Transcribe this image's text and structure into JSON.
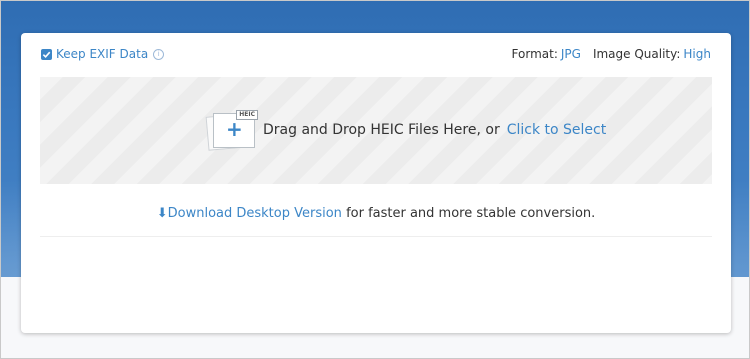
{
  "options": {
    "keep_exif_label": "Keep EXIF Data",
    "info_icon": "ⓘ",
    "format_label": "Format:",
    "format_value": "JPG",
    "quality_label": "Image Quality:",
    "quality_value": "High"
  },
  "dropzone": {
    "file_badge": "HEIC",
    "prompt": "Drag and Drop HEIC Files Here, or",
    "select_link": "Click to Select"
  },
  "download": {
    "link_label": "Download Desktop Version",
    "suffix": " for faster and more stable conversion."
  },
  "colors": {
    "accent": "#3c86c7",
    "background_blue": "#3a79bf"
  },
  "icons": {
    "checkbox": "check-icon",
    "info": "info-icon",
    "upload": "file-plus-icon",
    "download": "download-arrow-icon"
  }
}
